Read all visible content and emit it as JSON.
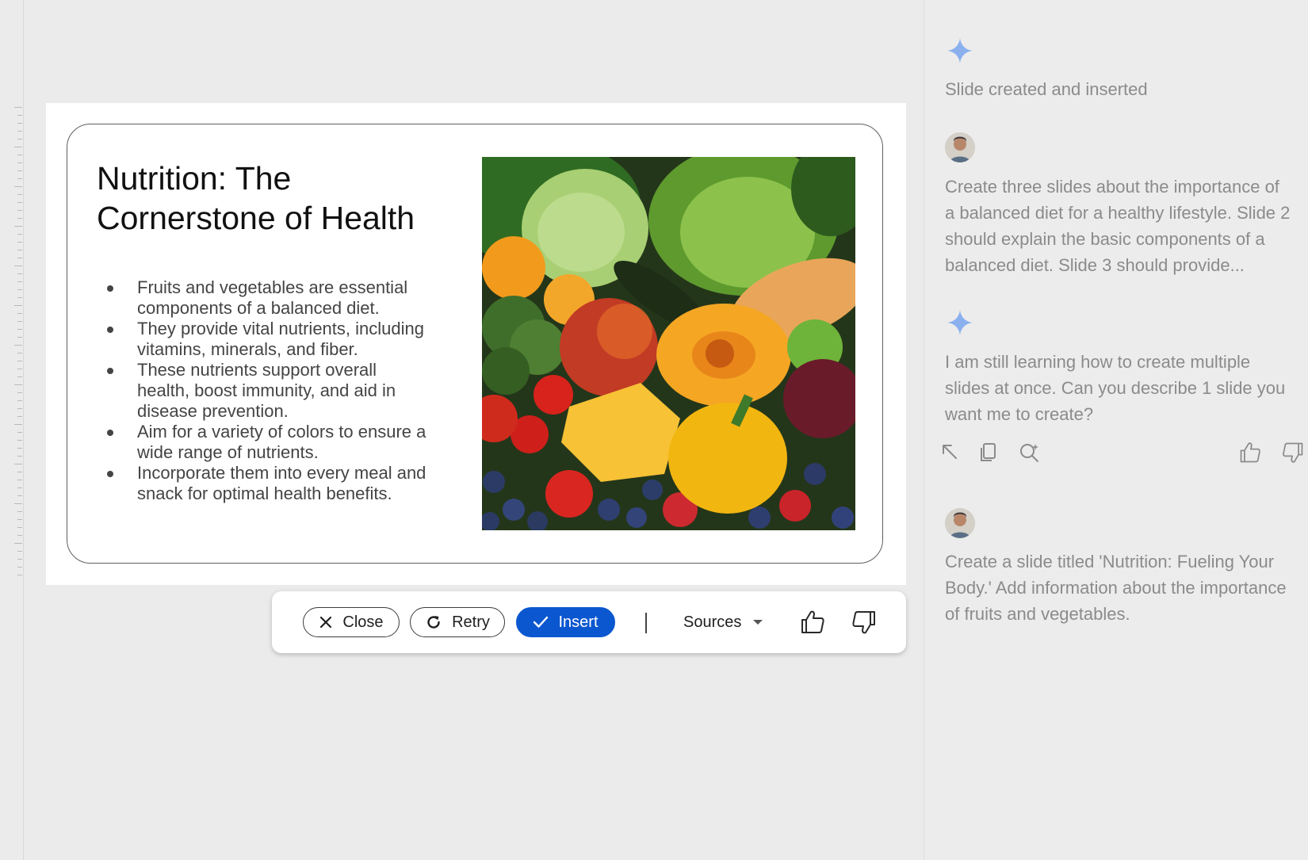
{
  "slide": {
    "title_line1": "Nutrition: The",
    "title_line2": "Cornerstone of Health",
    "bullets": [
      [
        "Fruits and vegetables are essential",
        "components of a balanced diet."
      ],
      [
        "They provide vital nutrients, including",
        "vitamins, minerals, and fiber."
      ],
      [
        "These nutrients support overall",
        "health, boost immunity, and aid in",
        "disease prevention."
      ],
      [
        "Aim for a variety of colors to ensure a",
        "wide range of nutrients."
      ],
      [
        "Incorporate them into every meal and",
        "snack for optimal health benefits."
      ]
    ],
    "image_icon": "fruits-vegetables-photo"
  },
  "toolbar": {
    "close_label": "Close",
    "retry_label": "Retry",
    "insert_label": "Insert",
    "sources_label": "Sources",
    "insert_color": "#0b57d0"
  },
  "panel": {
    "top_partial": "...",
    "msg1": "Slide created and inserted",
    "user_msg1": [
      "Create three slides about the importance of",
      "a balanced diet for a healthy lifestyle. Slide 2",
      "should explain the basic components of a",
      "balanced diet. Slide 3 should provide..."
    ],
    "msg2": [
      "I am still learning how to create multiple",
      "slides at once. Can you describe 1 slide you",
      "want me to create?"
    ],
    "user_msg2": [
      "Create a slide titled 'Nutrition: Fueling Your",
      "Body.' Add information about the importance",
      "of fruits and vegetables."
    ],
    "sparkle_color": "#8ab0ee"
  }
}
